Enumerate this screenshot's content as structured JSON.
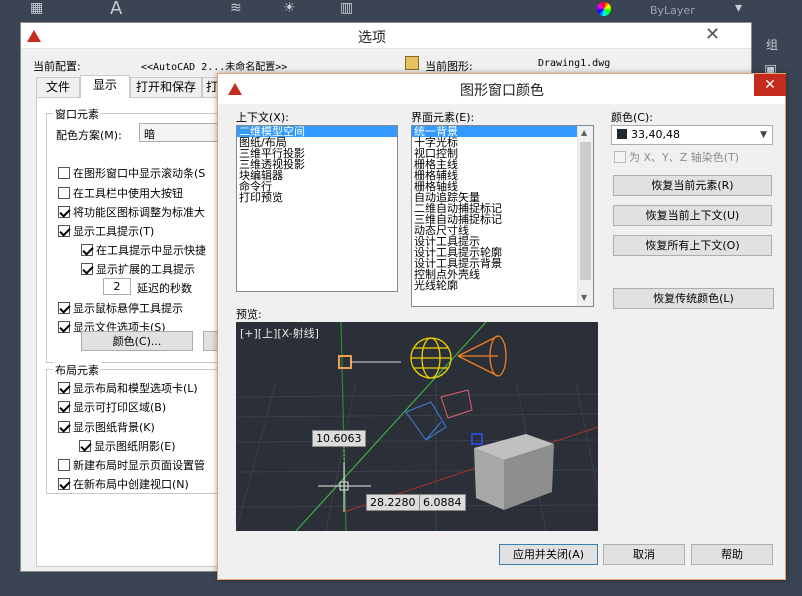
{
  "cad": {
    "layer_dropdown": "ByLayer",
    "side_label": "组"
  },
  "options_dialog": {
    "title": "选项",
    "current_profile_label": "当前配置:",
    "current_profile_value": "<<AutoCAD 2...未命名配置>>",
    "current_drawing_label": "当前图形:",
    "current_drawing_value": "Drawing1.dwg",
    "tabs": [
      "文件",
      "显示",
      "打开和保存",
      "打"
    ],
    "window_elements": {
      "legend": "窗口元素",
      "color_scheme_label": "配色方案(M):",
      "color_scheme_value": "暗",
      "items": [
        {
          "label": "在图形窗口中显示滚动条(S",
          "checked": false
        },
        {
          "label": "在工具栏中使用大按钮",
          "checked": false
        },
        {
          "label": "将功能区图标调整为标准大",
          "checked": true
        },
        {
          "label": "显示工具提示(T)",
          "checked": true
        },
        {
          "label": "在工具提示中显示快捷",
          "checked": true
        },
        {
          "label": "显示扩展的工具提示",
          "checked": true
        },
        {
          "label": "显示鼠标悬停工具提示",
          "checked": true
        },
        {
          "label": "显示文件选项卡(S)",
          "checked": true
        }
      ],
      "delay_value": "2",
      "delay_label": "延迟的秒数",
      "colors_button": "颜色(C)..."
    },
    "layout_elements": {
      "legend": "布局元素",
      "items": [
        {
          "label": "显示布局和模型选项卡(L)",
          "checked": true
        },
        {
          "label": "显示可打印区域(B)",
          "checked": true
        },
        {
          "label": "显示图纸背景(K)",
          "checked": true
        },
        {
          "label": "显示图纸阴影(E)",
          "checked": true
        },
        {
          "label": "新建布局时显示页面设置管",
          "checked": false
        },
        {
          "label": "在新布局中创建视口(N)",
          "checked": true
        }
      ]
    }
  },
  "color_dialog": {
    "title": "图形窗口颜色",
    "context_label": "上下文(X):",
    "context_items": [
      "二维模型空间",
      "图纸/布局",
      "三维平行投影",
      "三维透视投影",
      "块编辑器",
      "命令行",
      "打印预览"
    ],
    "context_selected": 0,
    "interface_label": "界面元素(E):",
    "interface_items": [
      "统一背景",
      "十字光标",
      "视口控制",
      "栅格主线",
      "栅格辅线",
      "栅格轴线",
      "自动追踪矢量",
      "二维自动捕捉标记",
      "三维自动捕捉标记",
      "动态尺寸线",
      "设计工具提示",
      "设计工具提示轮廓",
      "设计工具提示背景",
      "控制点外壳线",
      "光线轮廓"
    ],
    "interface_selected": 0,
    "color_label": "颜色(C):",
    "color_value": "33,40,48",
    "color_swatch": "#212830",
    "tint_label": "为 X、Y、Z 轴染色(T)",
    "restore_current_element": "恢复当前元素(R)",
    "restore_current_context": "恢复当前上下文(U)",
    "restore_all_contexts": "恢复所有上下文(O)",
    "restore_classic": "恢复传统颜色(L)",
    "preview_label": "预览:",
    "viewport_label": "[+][上][X-射线]",
    "dim_value_1": "10.6063",
    "dim_value_2": "28.2280",
    "dim_value_3": "6.0884",
    "apply_close": "应用并关闭(A)",
    "cancel": "取消",
    "help": "帮助"
  }
}
